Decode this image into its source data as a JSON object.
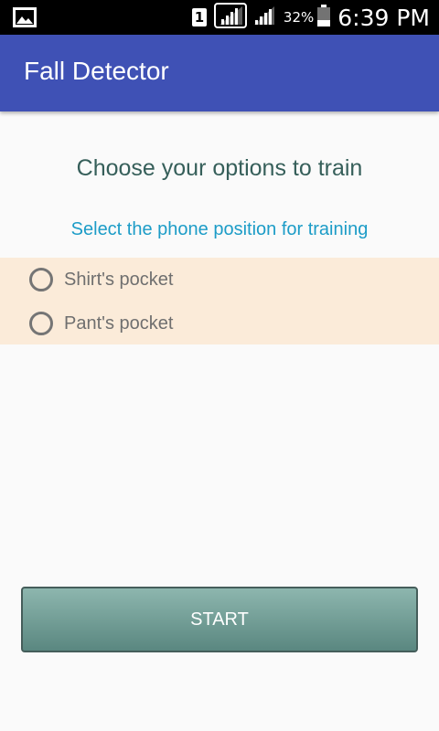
{
  "status_bar": {
    "sim_slot": "1",
    "battery_percent": "32%",
    "time": "6:39 PM",
    "icons": [
      "image-notification-icon",
      "sim-icon",
      "signal-icon",
      "signal-icon",
      "battery-icon"
    ]
  },
  "app_bar": {
    "title": "Fall Detector",
    "color": "#3f51b5"
  },
  "main": {
    "heading": "Choose your options to train",
    "subheading": "Select the phone position for training",
    "options": [
      {
        "label": "Shirt's pocket",
        "selected": false
      },
      {
        "label": "Pant's pocket",
        "selected": false
      }
    ],
    "start_label": "START"
  }
}
